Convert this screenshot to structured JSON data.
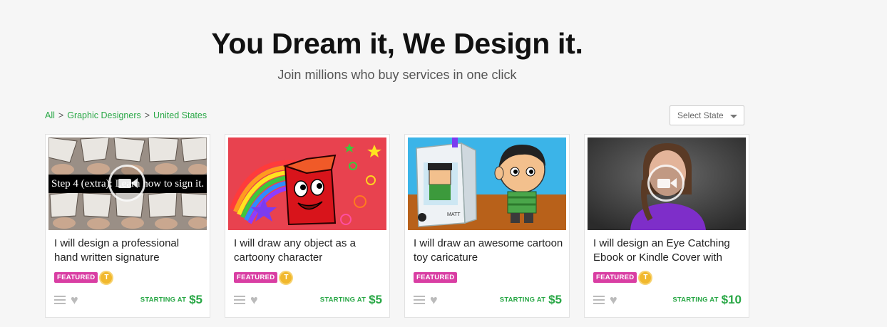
{
  "hero": {
    "title": "You Dream it, We Design it.",
    "subtitle": "Join millions who buy services in one click"
  },
  "breadcrumb": {
    "items": [
      "All",
      "Graphic Designers",
      "United States"
    ],
    "separator": ">"
  },
  "state_select": {
    "value": "Select State"
  },
  "colors": {
    "accent_green": "#28a745",
    "featured_pink": "#d93ea3",
    "badge_gold": "#f1b82d"
  },
  "cards": [
    {
      "title": "I will design a professional hand written signature",
      "featured_label": "FEATURED",
      "level_badge": "T",
      "starting_label": "STARTING AT",
      "price": "$5",
      "has_video": true,
      "thumb_overlay_text": "Step 4 (extra): Learn how to sign it."
    },
    {
      "title": "I will draw any object as a cartoony character",
      "featured_label": "FEATURED",
      "level_badge": "T",
      "starting_label": "STARTING AT",
      "price": "$5",
      "has_video": false
    },
    {
      "title": "I will draw an awesome cartoon toy caricature",
      "featured_label": "FEATURED",
      "starting_label": "STARTING AT",
      "price": "$5",
      "has_video": false,
      "box_text": "MATT"
    },
    {
      "title": "I will design an Eye Catching Ebook or Kindle Cover with",
      "featured_label": "FEATURED",
      "level_badge": "T",
      "starting_label": "STARTING AT",
      "price": "$10",
      "has_video": true
    }
  ],
  "icons": [
    "menu-icon",
    "heart-icon",
    "video-camera-icon",
    "caret-down-icon"
  ]
}
